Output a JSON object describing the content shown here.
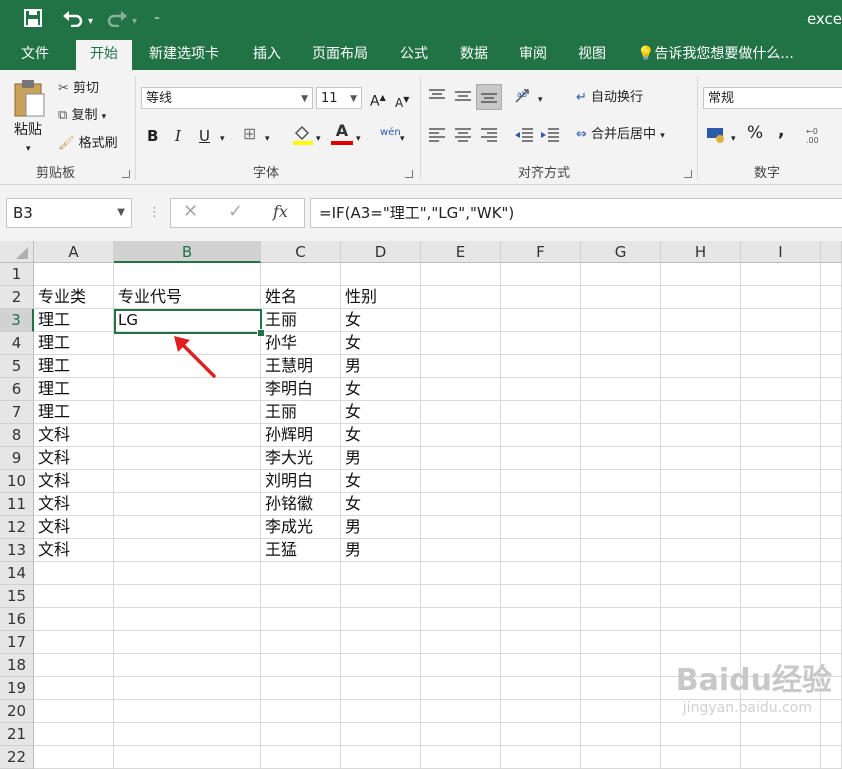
{
  "app": {
    "title": "exce"
  },
  "quick_access": {
    "save_icon": "save-icon",
    "undo_icon": "undo-icon",
    "redo_icon": "redo-icon",
    "customize_icon": "customize-icon"
  },
  "tabs": [
    "文件",
    "开始",
    "新建选项卡",
    "插入",
    "页面布局",
    "公式",
    "数据",
    "审阅",
    "视图"
  ],
  "tell_me": "告诉我您想要做什么...",
  "ribbon": {
    "clipboard": {
      "paste": "粘贴",
      "cut": "剪切",
      "copy": "复制",
      "format_painter": "格式刷",
      "label": "剪贴板"
    },
    "font": {
      "font_name": "等线",
      "font_size": "11",
      "bold": "B",
      "italic": "I",
      "underline": "U",
      "font_color_glyph": "A",
      "wen": "wén",
      "label": "字体"
    },
    "alignment": {
      "wrap_text": "自动换行",
      "merge_center": "合并后居中",
      "label": "对齐方式"
    },
    "number": {
      "format": "常规",
      "percent": "%",
      "comma": ",",
      "label": "数字"
    }
  },
  "formula_bar": {
    "name_box": "B3",
    "formula": "=IF(A3=\"理工\",\"LG\",\"WK\")",
    "fx": "fx"
  },
  "columns": [
    "A",
    "B",
    "C",
    "D",
    "E",
    "F",
    "G",
    "H",
    "I"
  ],
  "rows": [
    "1",
    "2",
    "3",
    "4",
    "5",
    "6",
    "7",
    "8",
    "9",
    "10",
    "11",
    "12",
    "13",
    "14",
    "15",
    "16",
    "17",
    "18",
    "19",
    "20",
    "21",
    "22"
  ],
  "cells": {
    "A2": "专业类",
    "B2": "专业代号",
    "C2": "姓名",
    "D2": "性别",
    "A3": "理工",
    "B3": "LG",
    "C3": "王丽",
    "D3": "女",
    "A4": "理工",
    "C4": "孙华",
    "D4": "女",
    "A5": "理工",
    "C5": "王慧明",
    "D5": "男",
    "A6": "理工",
    "C6": "李明白",
    "D6": "女",
    "A7": "理工",
    "C7": "王丽",
    "D7": "女",
    "A8": "文科",
    "C8": "孙辉明",
    "D8": "女",
    "A9": "文科",
    "C9": "李大光",
    "D9": "男",
    "A10": "文科",
    "C10": "刘明白",
    "D10": "女",
    "A11": "文科",
    "C11": "孙铭徽",
    "D11": "女",
    "A12": "文科",
    "C12": "李成光",
    "D12": "男",
    "A13": "文科",
    "C13": "王猛",
    "D13": "男"
  },
  "selected_cell": "B3",
  "watermark": {
    "main": "Baidu经验",
    "sub": "jingyan.baidu.com"
  },
  "colors": {
    "accent": "#217346",
    "arrow": "#e02020"
  }
}
